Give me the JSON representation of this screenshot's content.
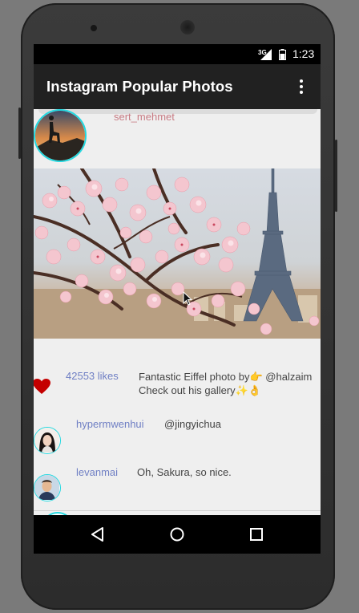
{
  "status_bar": {
    "network": "3G",
    "time": "1:23"
  },
  "app_bar": {
    "title": "Instagram Popular Photos",
    "menu_icon": "overflow-menu-icon"
  },
  "post": {
    "username": "sert_mehmet",
    "likes": "42553 likes",
    "caption": "Fantastic Eiffel photo by👉 @halzaim Check out his gallery✨👌"
  },
  "comments": [
    {
      "username": "hypermwenhui",
      "text": "@jingyichua"
    },
    {
      "username": "levanmai",
      "text": "Oh, Sakura, so nice."
    }
  ],
  "colors": {
    "accent_ring": "#22d8e0",
    "username": "#c87c84",
    "link_blue": "#6f7fc4",
    "heart": "#c40000",
    "app_bar": "#212121"
  },
  "nav_bar": {
    "back_icon": "back-triangle-icon",
    "home_icon": "home-circle-icon",
    "recents_icon": "recents-square-icon"
  }
}
